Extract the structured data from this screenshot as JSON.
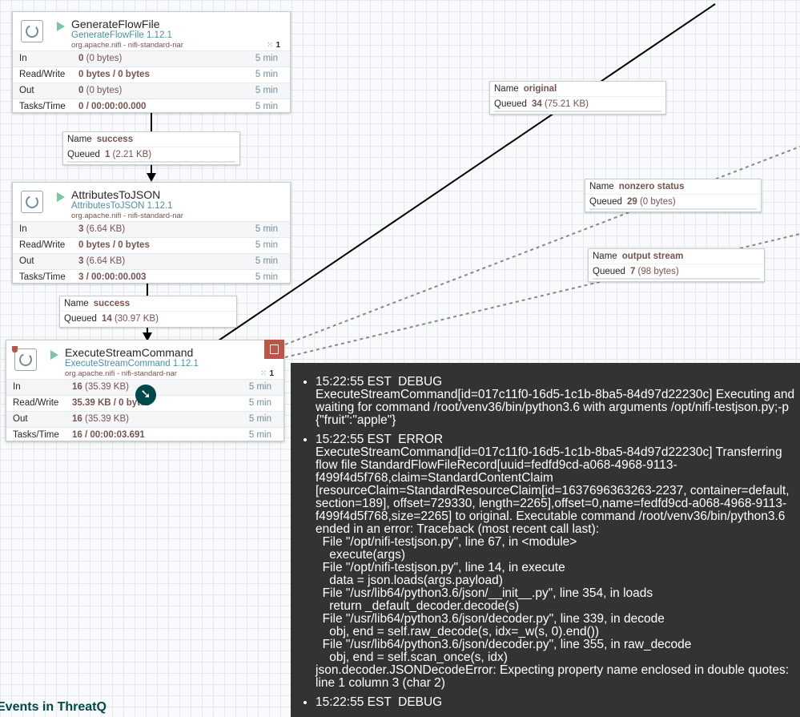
{
  "processors": [
    {
      "name": "GenerateFlowFile",
      "type": "GenerateFlowFile 1.12.1",
      "bundle": "org.apache.nifi - nifi-standard-nar",
      "tasks": "1",
      "icon": "processor-icon",
      "stats": [
        {
          "label": "In",
          "value": "0",
          "unit": "(0 bytes)",
          "time": "5 min"
        },
        {
          "label": "Read/Write",
          "value": "0 bytes / 0 bytes",
          "unit": "",
          "time": "5 min"
        },
        {
          "label": "Out",
          "value": "0",
          "unit": "(0 bytes)",
          "time": "5 min"
        },
        {
          "label": "Tasks/Time",
          "value": "0 / 00:00:00.000",
          "unit": "",
          "time": "5 min"
        }
      ]
    },
    {
      "name": "AttributesToJSON",
      "type": "AttributesToJSON 1.12.1",
      "bundle": "org.apache.nifi - nifi-standard-nar",
      "tasks": "",
      "icon": "processor-icon",
      "stats": [
        {
          "label": "In",
          "value": "3",
          "unit": "(6.64 KB)",
          "time": "5 min"
        },
        {
          "label": "Read/Write",
          "value": "0 bytes / 0 bytes",
          "unit": "",
          "time": "5 min"
        },
        {
          "label": "Out",
          "value": "3",
          "unit": "(6.64 KB)",
          "time": "5 min"
        },
        {
          "label": "Tasks/Time",
          "value": "3 / 00:00:00.003",
          "unit": "",
          "time": "5 min"
        }
      ]
    },
    {
      "name": "ExecuteStreamCommand",
      "type": "ExecuteStreamCommand 1.12.1",
      "bundle": "org.apache.nifi - nifi-standard-nar",
      "tasks": "1",
      "icon": "processor-icon",
      "stats": [
        {
          "label": "In",
          "value": "16",
          "unit": "(35.39 KB)",
          "time": "5 min"
        },
        {
          "label": "Read/Write",
          "value": "35.39 KB / 0 bytes",
          "unit": "",
          "time": "5 min"
        },
        {
          "label": "Out",
          "value": "16",
          "unit": "(35.39 KB)",
          "time": "5 min"
        },
        {
          "label": "Tasks/Time",
          "value": "16 / 00:00:03.691",
          "unit": "",
          "time": "5 min"
        }
      ]
    }
  ],
  "connections": [
    {
      "name_label": "Name",
      "name": "success",
      "queued_label": "Queued",
      "queued": "1",
      "size": "(2.21 KB)"
    },
    {
      "name_label": "Name",
      "name": "success",
      "queued_label": "Queued",
      "queued": "14",
      "size": "(30.97 KB)"
    },
    {
      "name_label": "Name",
      "name": "original",
      "queued_label": "Queued",
      "queued": "34",
      "size": "(75.21 KB)"
    },
    {
      "name_label": "Name",
      "name": "nonzero status",
      "queued_label": "Queued",
      "queued": "29",
      "size": "(0 bytes)"
    },
    {
      "name_label": "Name",
      "name": "output stream",
      "queued_label": "Queued",
      "queued": "7",
      "size": "(98 bytes)"
    }
  ],
  "bulletins": [
    {
      "text": "15:22:55 EST  DEBUG\nExecuteStreamCommand[id=017c11f0-16d5-1c1b-8ba5-84d97d22230c] Executing and waiting for command /root/venv36/bin/python3.6 with arguments /opt/nifi-testjson.py;-p {\"fruit\":\"apple\"}"
    },
    {
      "text": "15:22:55 EST  ERROR\nExecuteStreamCommand[id=017c11f0-16d5-1c1b-8ba5-84d97d22230c] Transferring flow file StandardFlowFileRecord[uuid=fedfd9cd-a068-4968-9113-f499f4d5f768,claim=StandardContentClaim [resourceClaim=StandardResourceClaim[id=1637696363263-2237, container=default, section=189], offset=729330, length=2265],offset=0,name=fedfd9cd-a068-4968-9113-f499f4d5f768,size=2265] to original. Executable command /root/venv36/bin/python3.6 ended in an error: Traceback (most recent call last):\n  File \"/opt/nifi-testjson.py\", line 67, in <module>\n    execute(args)\n  File \"/opt/nifi-testjson.py\", line 14, in execute\n    data = json.loads(args.payload)\n  File \"/usr/lib64/python3.6/json/__init__.py\", line 354, in loads\n    return _default_decoder.decode(s)\n  File \"/usr/lib64/python3.6/json/decoder.py\", line 339, in decode\n    obj, end = self.raw_decode(s, idx=_w(s, 0).end())\n  File \"/usr/lib64/python3.6/json/decoder.py\", line 355, in raw_decode\n    obj, end = self.scan_once(s, idx)\njson.decoder.JSONDecodeError: Expecting property name enclosed in double quotes: line 1 column 3 (char 2)"
    },
    {
      "text": "15:22:55 EST  DEBUG"
    }
  ],
  "bottom_link": "Events in ThreatQ",
  "colors": {
    "processor_border": "#c5ced4",
    "value_color": "#775351",
    "type_color": "#4a90a8",
    "tooltip_bg": "#333333",
    "bulletin_red": "#ba554a",
    "run_green": "#7dc7a0"
  }
}
